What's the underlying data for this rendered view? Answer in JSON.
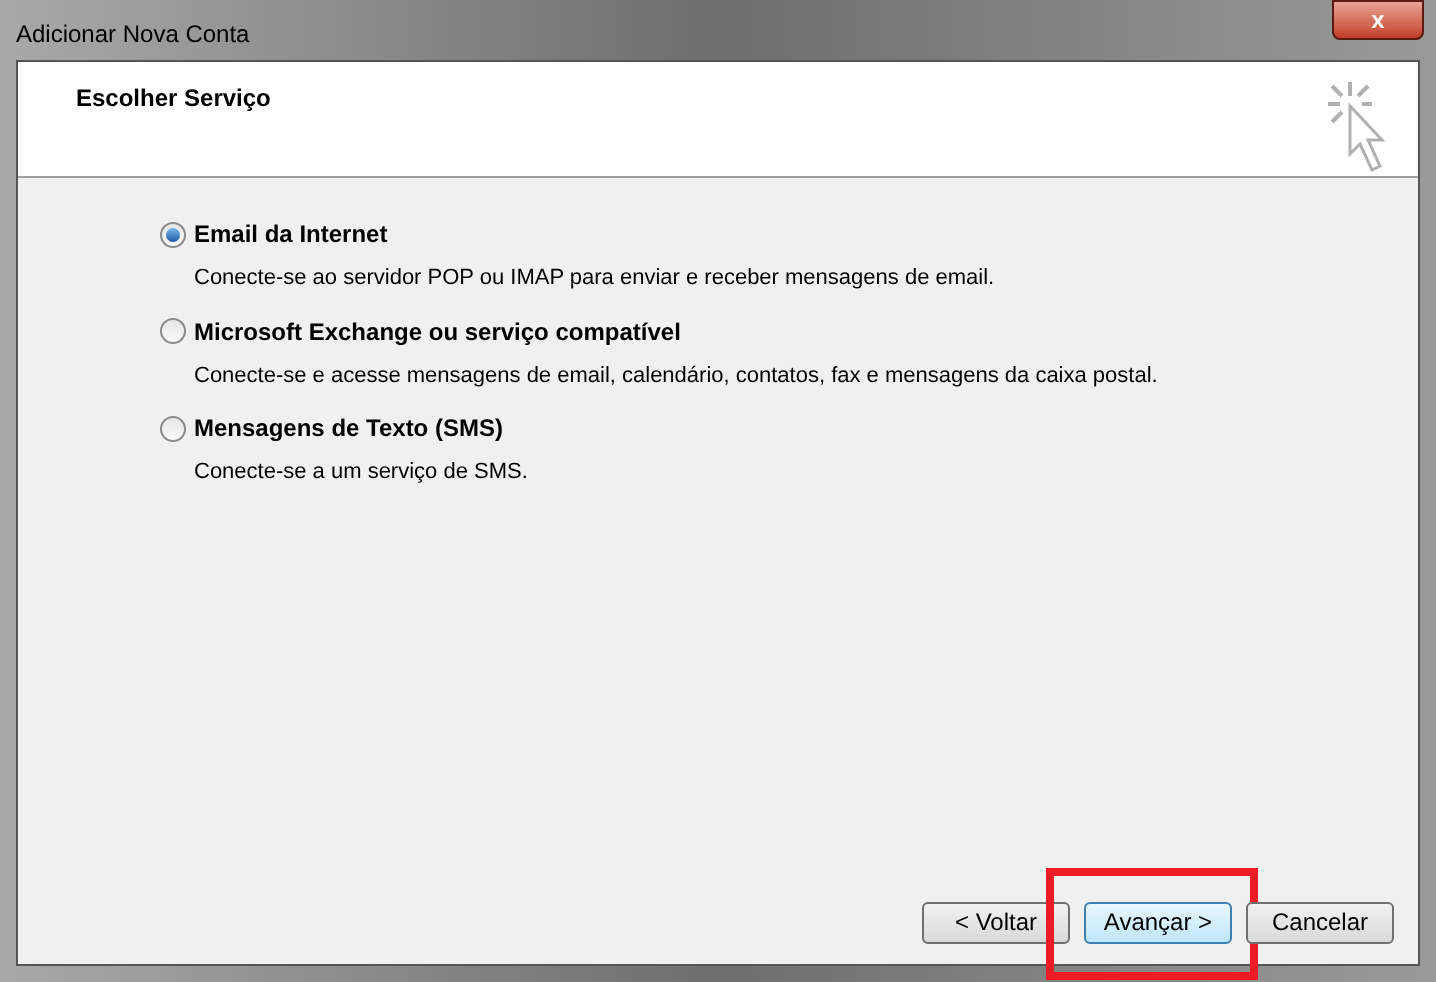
{
  "window": {
    "title": "Adicionar Nova Conta",
    "close": "x"
  },
  "header": {
    "title": "Escolher Serviço"
  },
  "options": [
    {
      "label": "Email da Internet",
      "description": "Conecte-se ao servidor POP ou IMAP para enviar e receber mensagens de email.",
      "selected": true
    },
    {
      "label": "Microsoft Exchange ou serviço compatível",
      "description": "Conecte-se e acesse mensagens de email, calendário, contatos, fax e mensagens da caixa postal.",
      "selected": false
    },
    {
      "label": "Mensagens de Texto (SMS)",
      "description": "Conecte-se a um serviço de SMS.",
      "selected": false
    }
  ],
  "buttons": [
    {
      "label": "< Voltar",
      "default": false,
      "highlighted": false
    },
    {
      "label": "Avançar >",
      "default": true,
      "highlighted": true
    },
    {
      "label": "Cancelar",
      "default": false,
      "highlighted": false
    }
  ]
}
